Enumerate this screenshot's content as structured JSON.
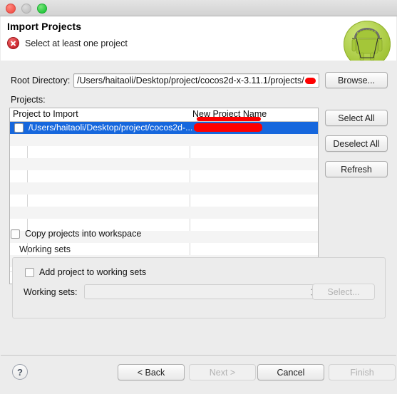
{
  "window": {
    "traffic_lights": [
      "close",
      "minimize",
      "zoom"
    ]
  },
  "header": {
    "title": "Import Projects",
    "status_message": "Select at least one project",
    "status_icon": "error-icon",
    "logo_icon": "android-logo-icon",
    "error_color": "#c9232b",
    "android_green": "#a4c639"
  },
  "form": {
    "root_directory_label": "Root Directory:",
    "root_directory_value": "/Users/haitaoli/Desktop/project/cocos2d-x-3.11.1/projects/",
    "root_directory_redacted": true,
    "browse_label": "Browse...",
    "projects_label": "Projects:"
  },
  "table": {
    "columns": [
      "Project to Import",
      "New Project Name"
    ],
    "rows": [
      {
        "checked": false,
        "project_to_import": "/Users/haitaoli/Desktop/project/cocos2d-...",
        "new_project_name": "",
        "new_project_name_redacted": true,
        "selected": true
      }
    ],
    "empty_row_count": 11,
    "selection_color": "#1667dd",
    "redaction_color": "#fe0000"
  },
  "side_buttons": {
    "select_all": "Select All",
    "deselect_all": "Deselect All",
    "refresh": "Refresh"
  },
  "options": {
    "copy_projects_label": "Copy projects into workspace",
    "copy_projects_checked": false
  },
  "working_sets": {
    "group_title": "Working sets",
    "add_project_label": "Add project to working sets",
    "add_project_checked": false,
    "working_sets_label": "Working sets:",
    "working_sets_value": "",
    "select_label": "Select...",
    "select_enabled": false,
    "combo_enabled": false
  },
  "footer": {
    "help_label": "?",
    "back_label": "< Back",
    "next_label": "Next >",
    "cancel_label": "Cancel",
    "finish_label": "Finish",
    "back_enabled": true,
    "next_enabled": false,
    "cancel_enabled": true,
    "finish_enabled": false
  }
}
